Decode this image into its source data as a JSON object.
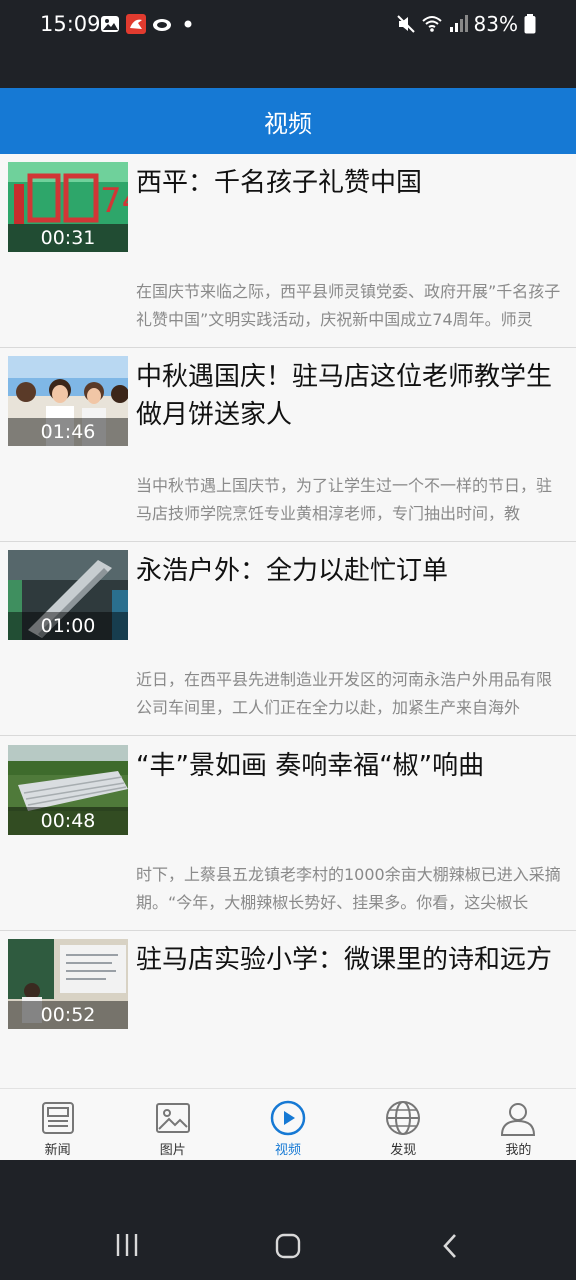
{
  "status_bar": {
    "time": "15:09",
    "battery": "83%",
    "left_icons": [
      "gallery-icon",
      "app-icon",
      "cloud-icon",
      "dot-icon"
    ],
    "right_icons": [
      "mute-icon",
      "wifi-icon",
      "signal-icon",
      "battery-icon"
    ]
  },
  "header": {
    "title": "视频"
  },
  "videos": [
    {
      "title": "西平：千名孩子礼赞中国",
      "duration": "00:31",
      "summary": "在国庆节来临之际，西平县师灵镇党委、政府开展”千名孩子礼赞中国”文明实践活动，庆祝新中国成立74周年。师灵"
    },
    {
      "title": "中秋遇国庆！驻马店这位老师教学生做月饼送家人",
      "duration": "01:46",
      "summary": "当中秋节遇上国庆节，为了让学生过一个不一样的节日，驻马店技师学院烹饪专业黄相淳老师，专门抽出时间，教"
    },
    {
      "title": "永浩户外：全力以赴忙订单",
      "duration": "01:00",
      "summary": "近日，在西平县先进制造业开发区的河南永浩户外用品有限公司车间里，工人们正在全力以赴，加紧生产来自海外"
    },
    {
      "title": "“丰”景如画 奏响幸福“椒”响曲",
      "duration": "00:48",
      "summary": "时下，上蔡县五龙镇老李村的1000余亩大棚辣椒已进入采摘期。“今年，大棚辣椒长势好、挂果多。你看，这尖椒长"
    },
    {
      "title": "驻马店实验小学：微课里的诗和远方",
      "duration": "00:52",
      "summary": ""
    }
  ],
  "tabs": [
    {
      "label": "新闻",
      "icon": "news-icon"
    },
    {
      "label": "图片",
      "icon": "picture-icon"
    },
    {
      "label": "视频",
      "icon": "video-play-icon",
      "active": true
    },
    {
      "label": "发现",
      "icon": "globe-icon"
    },
    {
      "label": "我的",
      "icon": "user-icon"
    }
  ],
  "system_nav": [
    "recents-button",
    "home-button",
    "back-button"
  ],
  "colors": {
    "accent": "#1679d4",
    "status_bar_bg": "#1f2227"
  }
}
